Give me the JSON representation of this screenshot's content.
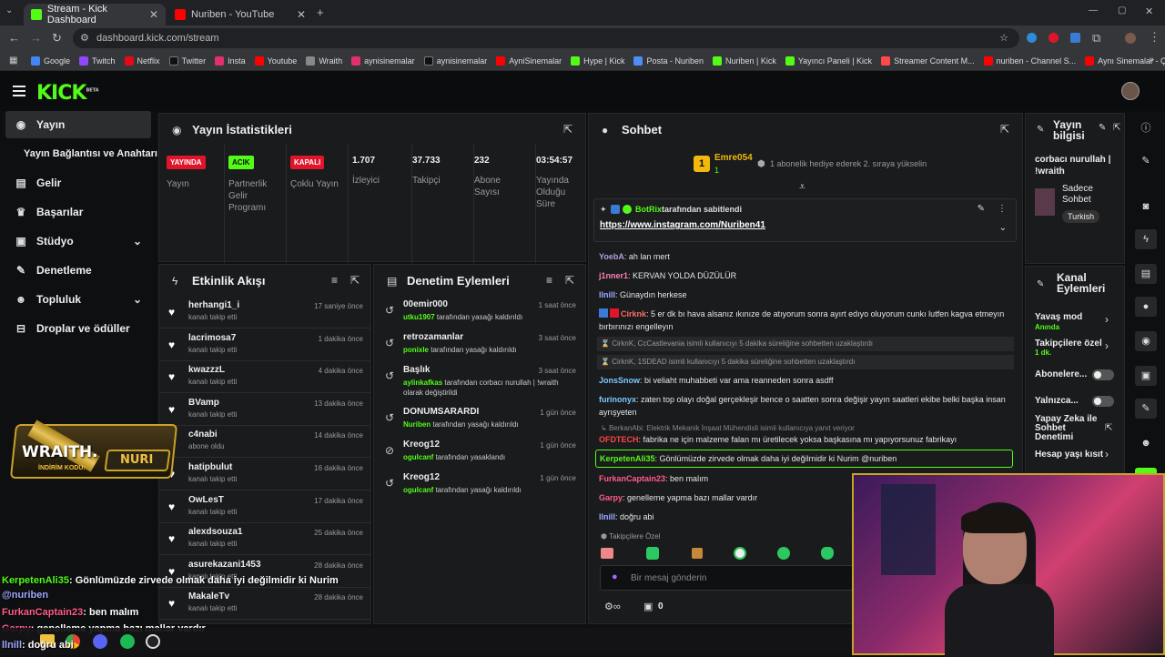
{
  "browser": {
    "tabs": [
      {
        "title": "Stream - Kick Dashboard",
        "favicon_color": "#53fc18",
        "active": true
      },
      {
        "title": "Nuriben - YouTube",
        "favicon_color": "#ff0000",
        "active": false
      }
    ],
    "url": "dashboard.kick.com/stream",
    "bookmarks": [
      {
        "label": "Google",
        "color": "#4285f4"
      },
      {
        "label": "Twitch",
        "color": "#9146ff"
      },
      {
        "label": "Netflix",
        "color": "#e50914"
      },
      {
        "label": "Twitter",
        "color": "#111111"
      },
      {
        "label": "Insta",
        "color": "#e1306c"
      },
      {
        "label": "Youtube",
        "color": "#ff0000"
      },
      {
        "label": "Wraith",
        "color": "#888888"
      },
      {
        "label": "aynisinemalar",
        "color": "#e1306c"
      },
      {
        "label": "aynisinemalar",
        "color": "#111111"
      },
      {
        "label": "AyniSinemalar",
        "color": "#ff0000"
      },
      {
        "label": "Hype | Kick",
        "color": "#53fc18"
      },
      {
        "label": "Posta - Nuriben",
        "color": "#4f8ef7"
      },
      {
        "label": "Nuriben | Kick",
        "color": "#53fc18"
      },
      {
        "label": "Yayıncı Paneli | Kick",
        "color": "#53fc18"
      },
      {
        "label": "Streamer Content M...",
        "color": "#ff4a4a"
      },
      {
        "label": "nuriben - Channel S...",
        "color": "#ff0000"
      },
      {
        "label": "Aynı Sinemalar - Ça...",
        "color": "#ff0000"
      }
    ]
  },
  "brand": {
    "logo": "KICK",
    "beta": "BETA",
    "accent": "#53fc18"
  },
  "sidebar": {
    "items": [
      {
        "label": "Yayın",
        "icon": "broadcast-icon"
      },
      {
        "label": "Yayın Bağlantısı ve Anahtarı",
        "icon": ""
      },
      {
        "label": "Gelir",
        "icon": "chart-icon"
      },
      {
        "label": "Başarılar",
        "icon": "trophy-icon"
      },
      {
        "label": "Stüdyo",
        "icon": "studio-icon"
      },
      {
        "label": "Denetleme",
        "icon": "wrench-icon"
      },
      {
        "label": "Topluluk",
        "icon": "community-icon"
      },
      {
        "label": "Droplar ve ödüller",
        "icon": "drops-icon"
      }
    ]
  },
  "stats": {
    "title": "Yayın İstatistikleri",
    "items": [
      {
        "badge": "YAYINDA",
        "badge_color": "#e0152b",
        "label": "Yayın"
      },
      {
        "badge": "ACIK",
        "badge_color": "#53fc18",
        "label": "Partnerlik Gelir Programı"
      },
      {
        "badge": "KAPALI",
        "badge_color": "#e0152b",
        "label": "Çoklu Yayın"
      },
      {
        "value": "1.707",
        "label": "İzleyici"
      },
      {
        "value": "37.733",
        "label": "Takipçi"
      },
      {
        "value": "232",
        "label": "Abone Sayısı"
      },
      {
        "value": "03:54:57",
        "label": "Yayında Olduğu Süre"
      }
    ]
  },
  "activity": {
    "title": "Etkinlik Akışı",
    "rows": [
      {
        "name": "herhangi1_i",
        "sub": "kanalı takip etti",
        "time": "17 saniye önce"
      },
      {
        "name": "lacrimosa7",
        "sub": "kanalı takip etti",
        "time": "1 dakika önce"
      },
      {
        "name": "kwazzzL",
        "sub": "kanalı takip etti",
        "time": "4 dakika önce"
      },
      {
        "name": "BVamp",
        "sub": "kanalı takip etti",
        "time": "13 dakika önce"
      },
      {
        "name": "c4nabi",
        "sub": "abone oldu",
        "time": "14 dakika önce"
      },
      {
        "name": "hatipbulut",
        "sub": "kanalı takip etti",
        "time": "16 dakika önce"
      },
      {
        "name": "OwLesT",
        "sub": "kanalı takip etti",
        "time": "17 dakika önce"
      },
      {
        "name": "alexdsouza1",
        "sub": "kanalı takip etti",
        "time": "25 dakika önce"
      },
      {
        "name": "asurekazani1453",
        "sub": "kanalı takip etti",
        "time": "28 dakika önce"
      },
      {
        "name": "MakaleTv",
        "sub": "kanalı takip etti",
        "time": "28 dakika önce"
      }
    ]
  },
  "moderation": {
    "title": "Denetim Eylemleri",
    "rows": [
      {
        "name": "00emir000",
        "actor": "utku1907",
        "action": "tarafından yasağı kaldırıldı",
        "time": "1 saat önce"
      },
      {
        "name": "retrozamanlar",
        "actor": "ponixle",
        "action": "tarafından yasağı kaldırıldı",
        "time": "3 saat önce"
      },
      {
        "name": "Başlık",
        "actor": "aylinkafkas",
        "action": "tarafından corbacı nurullah | !wraith olarak değiştirildi",
        "time": "3 saat önce"
      },
      {
        "name": "DONUMSARARDI",
        "actor": "Nuriben",
        "action": "tarafından yasağı kaldırıldı",
        "time": "1 gün önce"
      },
      {
        "name": "Kreog12",
        "actor": "ogulcanf",
        "action": "tarafından yasaklandı",
        "time": "1 gün önce"
      },
      {
        "name": "Kreog12",
        "actor": "ogulcanf",
        "action": "tarafından yasağı kaldırıldı",
        "time": "1 gün önce"
      }
    ]
  },
  "chat": {
    "title": "Sohbet",
    "gift": {
      "rank": "1",
      "user": "Emre054",
      "count": "1",
      "text": "1 abonelik hediye ederek 2. sıraya yükselin"
    },
    "pinned": {
      "by": "BotRix",
      "label": "tarafından sabitlendi",
      "link": "https://www.instagram.com/Nuriben41"
    },
    "messages": [
      {
        "user": "YoebA",
        "color": "#b39ddb",
        "text": "ah lan mert"
      },
      {
        "user": "j1nner1",
        "color": "#ff7eb6",
        "text": "KERVAN YOLDA DÜZÜLÜR"
      },
      {
        "user": "llnill",
        "color": "#9fa8ff",
        "text": "Günaydın herkese"
      },
      {
        "user": "Cirknk",
        "color": "#ff6b6b",
        "text": "5 er dk bı hava alsanız ıkınıze de atıyorum sonra ayırt edıyo oluyorum cunkı lutfen kagva etmeyın bırbırınızı engelleyın"
      },
      {
        "user": "JonsSnow",
        "color": "#7ec8ff",
        "text": "bi veliaht muhabbeti var ama reanneden sonra asdff"
      },
      {
        "user": "furinonyx",
        "color": "#7ec8ff",
        "text": "zaten top olayı doğal gerçekleşir bence o saatten sonra değişir yayın saatleri ekibe belki başka insan ayrışyeten"
      },
      {
        "user": "OFDTECH",
        "color": "#ff4444",
        "text": "fabrika ne için malzeme falan mı üretilecek yoksa başkasına mı yapıyorsunuz fabrikayı"
      },
      {
        "user": "KerpetenAli35",
        "color": "#53fc18",
        "text": "Gönlümüzde zirvede olmak daha iyi değilmidir ki Nurim @nuriben"
      },
      {
        "user": "FurkanCaptain23",
        "color": "#ff5c8a",
        "text": "ben malım"
      },
      {
        "user": "Garpy",
        "color": "#ff5c8a",
        "text": "genelleme yapma bazı mallar vardır"
      },
      {
        "user": "llnill",
        "color": "#9fa8ff",
        "text": "doğru abi"
      }
    ],
    "system": [
      {
        "text": "CirknK, CcCastlevania isimli kullanıcıyı 5 dakika süreliğine sohbetten uzaklaştırdı"
      },
      {
        "text": "CirknK, 1SDEAD isimli kullanıcıyı 5 dakika süreliğine sohbetten uzaklaştırdı"
      }
    ],
    "reply": "BerkanAbi: Elektrik Mekanik İnşaat Mühendisli isimli kullanıcıya yanıt veriyor",
    "followers_only": "Takipçilere Özel",
    "input_placeholder": "Bir mesaj gönderin",
    "points": "0"
  },
  "stream_info": {
    "title": "Yayın bilgisi",
    "stream_title": "corbacı nurullah | !wraith",
    "mode": "Sadece Sohbet",
    "language": "Turkish"
  },
  "channel_actions": {
    "title": "Kanal Eylemleri",
    "items": [
      {
        "label": "Yavaş mod",
        "sub": "Anında",
        "kind": "chevron"
      },
      {
        "label": "Takipçilere özel",
        "sub": "1 dk.",
        "kind": "chevron"
      },
      {
        "label": "Abonelere...",
        "sub": "",
        "kind": "toggle"
      },
      {
        "label": "Yalnızca...",
        "sub": "",
        "kind": "toggle"
      },
      {
        "label": "Yapay Zeka ile Sohbet Denetimi",
        "sub": "",
        "kind": "external"
      },
      {
        "label": "Hesap yaşı kısıt",
        "sub": "",
        "kind": "chevron"
      }
    ]
  },
  "overlay": {
    "sponsor": "WRAITH.",
    "code_label": "İNDİRİM KODU:",
    "code": "NURI",
    "chat": [
      {
        "user": "KerpetenAli35",
        "color": "#53fc18",
        "text": ": Gönlümüzde zirvede olmak daha iyi değilmidir ki Nurim",
        "mention": "@nuriben"
      },
      {
        "user": "FurkanCaptain23",
        "color": "#ff5c8a",
        "text": ": ben malım"
      },
      {
        "user": "Garpy",
        "color": "#ff5c8a",
        "text": ": genelleme yapma bazı mallar vardır"
      },
      {
        "user": "llnill",
        "color": "#9fa8ff",
        "text": ": doğru abi"
      }
    ]
  }
}
